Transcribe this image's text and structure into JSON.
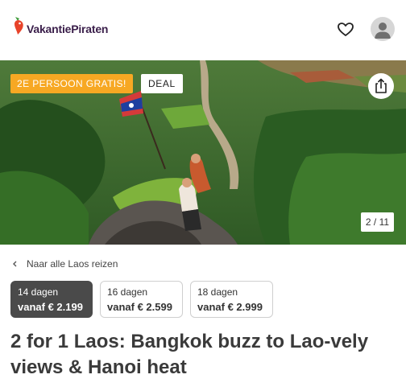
{
  "app": {
    "brand": "VakantiePiraten",
    "brand_color": "#e8432a"
  },
  "header": {
    "favorites_icon": "heart-icon",
    "account_icon": "user-avatar-icon"
  },
  "hero": {
    "promo_badge": "2E PERSOON GRATIS!",
    "promo_badge_color": "#f7a823",
    "deal_badge": "DEAL",
    "share_icon": "share-icon",
    "image_counter": "2 / 11"
  },
  "nav": {
    "back_label": "Naar alle Laos reizen"
  },
  "duration_options": [
    {
      "days": "14 dagen",
      "price": "vanaf € 2.199",
      "selected": true
    },
    {
      "days": "16 dagen",
      "price": "vanaf € 2.599",
      "selected": false
    },
    {
      "days": "18 dagen",
      "price": "vanaf € 2.999",
      "selected": false
    }
  ],
  "page": {
    "title": "2 for 1 Laos: Bangkok buzz to Lao-vely views & Hanoi heat"
  }
}
